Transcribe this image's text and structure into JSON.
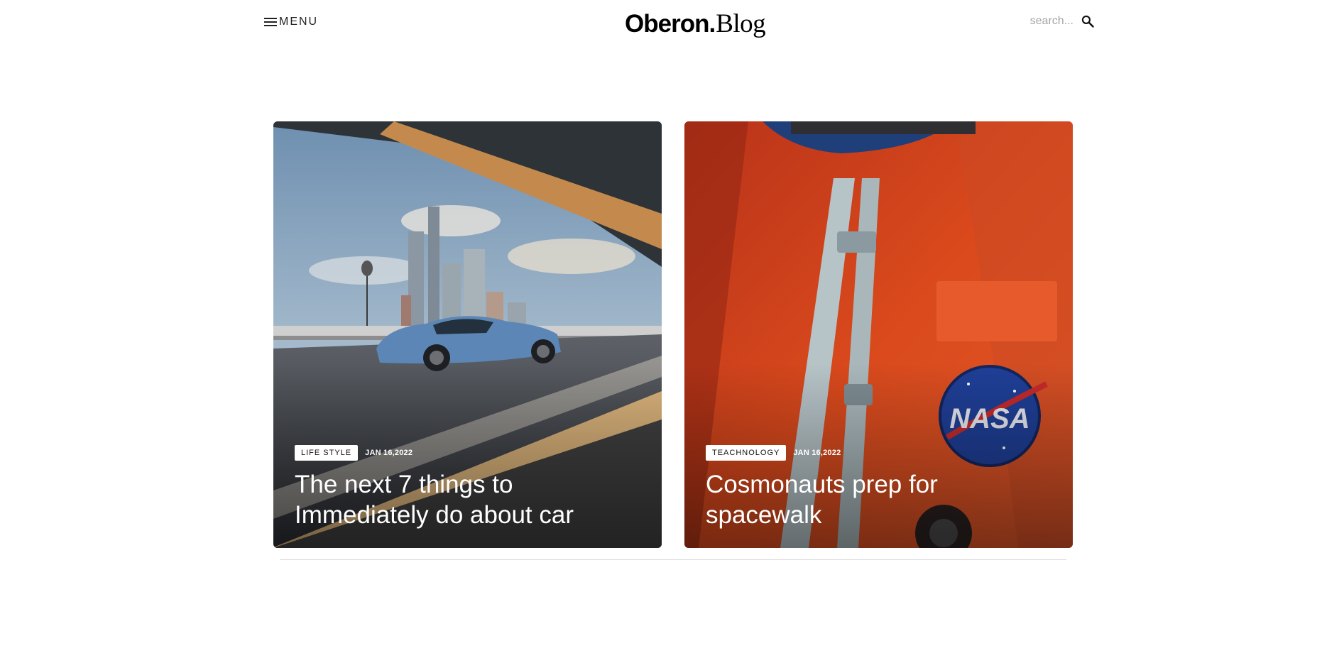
{
  "header": {
    "menu_label": "MENU",
    "logo_main": "Oberon",
    "logo_dot": ".",
    "logo_accent": "Blog",
    "search_placeholder": "search..."
  },
  "posts": [
    {
      "tag": "LIFE STYLE",
      "date": "JAN 16,2022",
      "title": "The next 7 things to Immediately do about car"
    },
    {
      "tag": "TEACHNOLOGY",
      "date": "JAN 16,2022",
      "title": "Cosmonauts prep for spacewalk"
    }
  ],
  "icons": {
    "menu": "hamburger-icon",
    "search": "search-icon"
  },
  "colors": {
    "background": "#ffffff",
    "text": "#111111",
    "suit_orange": "#d9491c",
    "car_blue": "#5b86b5"
  }
}
